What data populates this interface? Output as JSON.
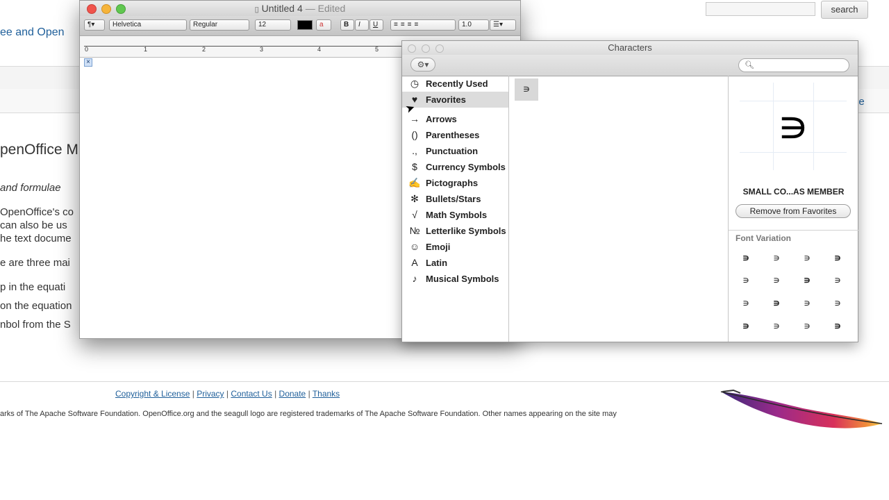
{
  "background_page": {
    "top_link": "ee and Open",
    "search": {
      "button_label": "search",
      "placeholder": ""
    },
    "right_link": "ge",
    "heading": "penOffice M",
    "italic_line": "and formulae",
    "lines": [
      "OpenOffice's co",
      "can also be us",
      "he text docume",
      "e are three mai",
      "p in the equati",
      "on the equation",
      "nbol from the S"
    ],
    "footer_links": [
      "Copyright & License",
      "Privacy",
      "Contact Us",
      "Donate",
      "Thanks"
    ],
    "footer_separator": "|",
    "footer_text": "arks of The Apache Software Foundation. OpenOffice.org and the seagull logo are registered trademarks of The Apache Software Foundation. Other names appearing on the site may"
  },
  "textedit": {
    "title": "Untitled 4",
    "edited": "— Edited",
    "toolbar": {
      "paragraph": "¶▾",
      "font": "Helvetica",
      "style": "Regular",
      "size": "12",
      "bold": "B",
      "italic": "I",
      "underline": "U",
      "spacing": "1.0",
      "list": "☰▾"
    },
    "ruler_numbers": [
      "0",
      "1",
      "2",
      "3",
      "4",
      "5"
    ],
    "cursor_glyph": "×"
  },
  "characters": {
    "title": "Characters",
    "gear": "⚙▾",
    "categories": [
      {
        "icon": "◷",
        "label": "Recently Used",
        "icon_name": "clock-icon"
      },
      {
        "icon": "♥",
        "label": "Favorites",
        "icon_name": "heart-icon",
        "selected": true
      },
      {
        "icon": "→",
        "label": "Arrows",
        "icon_name": "arrow-icon"
      },
      {
        "icon": "()",
        "label": "Parentheses",
        "icon_name": "parentheses-icon"
      },
      {
        "icon": ".,",
        "label": "Punctuation",
        "icon_name": "punctuation-icon"
      },
      {
        "icon": "$",
        "label": "Currency Symbols",
        "icon_name": "dollar-icon"
      },
      {
        "icon": "✍",
        "label": "Pictographs",
        "icon_name": "pictograph-icon"
      },
      {
        "icon": "✻",
        "label": "Bullets/Stars",
        "icon_name": "asterisk-icon"
      },
      {
        "icon": "√",
        "label": "Math Symbols",
        "icon_name": "sqrt-icon"
      },
      {
        "icon": "№",
        "label": "Letterlike Symbols",
        "icon_name": "numero-icon"
      },
      {
        "icon": "☺",
        "label": "Emoji",
        "icon_name": "smiley-icon"
      },
      {
        "icon": "A",
        "label": "Latin",
        "icon_name": "latin-a-icon"
      },
      {
        "icon": "♪",
        "label": "Musical Symbols",
        "icon_name": "music-note-icon"
      }
    ],
    "favorite_char": "∍",
    "preview_char": "∍",
    "char_name": "SMALL CO...AS MEMBER",
    "remove_button": "Remove from Favorites",
    "font_variation_title": "Font Variation",
    "font_variations": [
      "∍",
      "∍",
      "∍",
      "∍",
      "∍",
      "∍",
      "∍",
      "∍",
      "∍",
      "∍",
      "∍",
      "∍",
      "∍",
      "∍",
      "∍",
      "∍"
    ]
  }
}
